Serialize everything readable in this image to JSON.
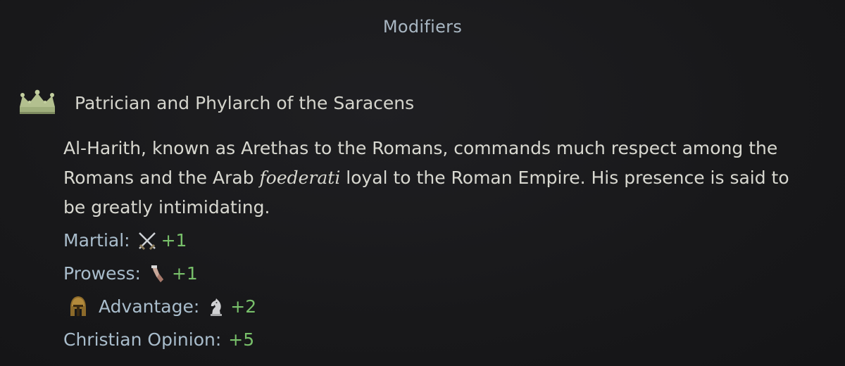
{
  "panel": {
    "title": "Modifiers"
  },
  "modifier": {
    "icon": "crown-icon",
    "name": "Patrician and Phylarch of the Saracens",
    "description_before": "Al-Harith, known as Arethas to the Romans, commands much respect among the Romans and the Arab ",
    "description_italic": "foederati",
    "description_after": " loyal to the Roman Empire. His presence is said to be greatly intimidating."
  },
  "effects": [
    {
      "label": "Martial:",
      "icon": "crossed-swords-icon",
      "value": "+1"
    },
    {
      "label": "Prowess:",
      "icon": "prowess-arm-icon",
      "value": "+1"
    },
    {
      "lead_icon": "helmet-icon",
      "label": "Advantage:",
      "icon": "chess-knight-icon",
      "value": "+2"
    },
    {
      "label": "Christian Opinion:",
      "value": "+5"
    }
  ],
  "colors": {
    "background": "#18181a",
    "title": "#a8b6c2",
    "label": "#a9bdcc",
    "positive_value": "#78c06a",
    "text": "#d8d8d0",
    "crown": "#9fae7c"
  }
}
